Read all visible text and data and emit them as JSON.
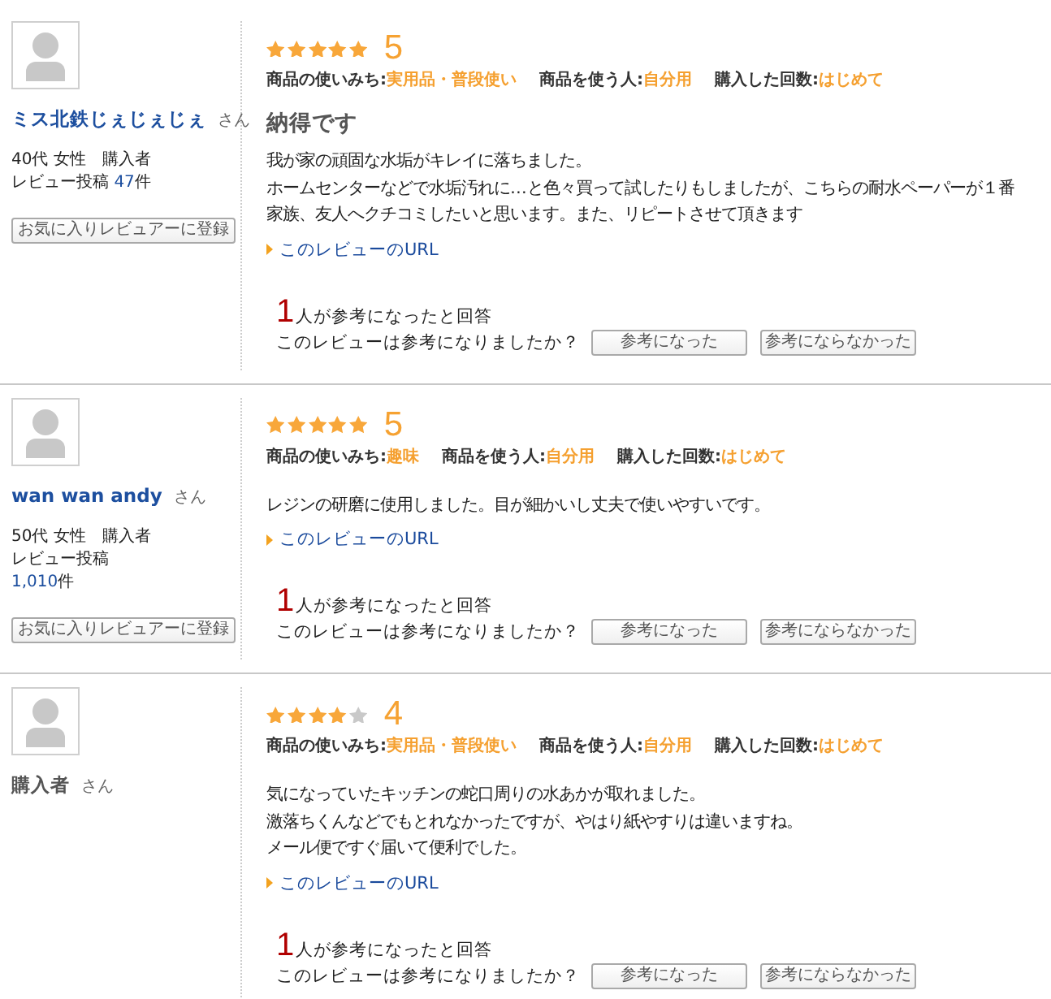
{
  "reviews": [
    {
      "reviewer": {
        "name": "ミス北鉄じぇじぇじぇ",
        "linked": true,
        "honorific": "さん",
        "profile": "40代 女性",
        "status": "購入者",
        "posts_label": "レビュー投稿",
        "posts_count": "47",
        "posts_unit": "件",
        "follow_button": "お気に入りレビュアーに登録"
      },
      "stars": 5,
      "score": "5",
      "details": [
        {
          "label": "商品の使いみち:",
          "value": "実用品・普段使い"
        },
        {
          "label": "商品を使う人:",
          "value": "自分用"
        },
        {
          "label": "購入した回数:",
          "value": "はじめて"
        }
      ],
      "title": "納得です",
      "body": [
        "我が家の頑固な水垢がキレイに落ちました。",
        "ホームセンターなどで水垢汚れに…と色々買って試したりもしましたが、こちらの耐水ペーパーが１番",
        "家族、友人へクチコミしたいと思います。また、リピートさせて頂きます"
      ],
      "url_link": "このレビューのURL",
      "helpful_count": "1",
      "helpful_text": "人が参考になったと回答",
      "question": "このレビューは参考になりましたか？",
      "vote_buttons": [
        "参考になった",
        "参考にならなかった"
      ]
    },
    {
      "reviewer": {
        "name": "wan wan andy",
        "linked": true,
        "honorific": "さん",
        "profile": "50代 女性",
        "status": "購入者",
        "posts_label": "レビュー投稿",
        "posts_count": "1,010",
        "posts_unit": "件",
        "follow_button": "お気に入りレビュアーに登録"
      },
      "stars": 5,
      "score": "5",
      "details": [
        {
          "label": "商品の使いみち:",
          "value": "趣味"
        },
        {
          "label": "商品を使う人:",
          "value": "自分用"
        },
        {
          "label": "購入した回数:",
          "value": "はじめて"
        }
      ],
      "body": [
        "レジンの研磨に使用しました。目が細かいし丈夫で使いやすいです。"
      ],
      "url_link": "このレビューのURL",
      "helpful_count": "1",
      "helpful_text": "人が参考になったと回答",
      "question": "このレビューは参考になりましたか？",
      "vote_buttons": [
        "参考になった",
        "参考にならなかった"
      ]
    },
    {
      "reviewer": {
        "name": "購入者",
        "linked": false,
        "honorific": "さん"
      },
      "stars": 4,
      "score": "4",
      "details": [
        {
          "label": "商品の使いみち:",
          "value": "実用品・普段使い"
        },
        {
          "label": "商品を使う人:",
          "value": "自分用"
        },
        {
          "label": "購入した回数:",
          "value": "はじめて"
        }
      ],
      "body": [
        "気になっていたキッチンの蛇口周りの水あかが取れました。",
        "激落ちくんなどでもとれなかったですが、やはり紙やすりは違いますね。",
        "メール便ですぐ届いて便利でした。"
      ],
      "url_link": "このレビューのURL",
      "helpful_count": "1",
      "helpful_text": "人が参考になったと回答",
      "question": "このレビューは参考になりましたか？",
      "vote_buttons": [
        "参考になった",
        "参考にならなかった"
      ]
    }
  ]
}
